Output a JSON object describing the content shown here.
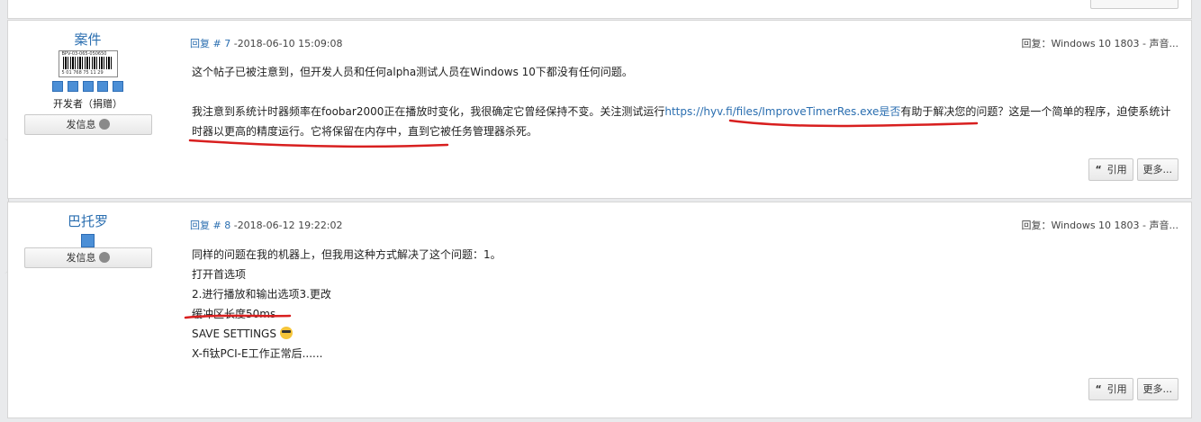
{
  "posts": [
    {
      "author": "案件",
      "role": "开发者（捐赠）",
      "rank_image_text": {
        "top": "BPV-03-065-050650",
        "bottom": "5 01 768 75 11 29"
      },
      "stars": 5,
      "pm_label": "发信息",
      "reply_label": "回复 # 7",
      "timestamp": "-2018-06-10 15:09:08",
      "forum": "回复：Windows 10 1803 - 声音...",
      "body": {
        "p1": "这个帖子已被注意到，但开发人员和任何alpha测试人员在Windows 10下都没有任何问题。",
        "p2_before": "我注意到系统计时器频率在foobar2000正在播放时变化，我很确定它曾经保持不变。关注测试运行",
        "link": "https://hyv.fi/files/ImproveTimerRes.exe是否",
        "p2_after": "有助于解决您的问题？这是一个简单的程序，迫使系统计时器以更高的精度运行。它将保留在内存中，直到它被任务管理器杀死。"
      },
      "quote_label": "引用",
      "more_label": "更多..."
    },
    {
      "author": "巴托罗",
      "stars": 1,
      "pm_label": "发信息",
      "reply_label": "回复 # 8",
      "timestamp": "-2018-06-12 19:22:02",
      "forum": "回复：Windows 10 1803 - 声音...",
      "body": {
        "l1": "同样的问题在我的机器上，但我用这种方式解决了这个问题：1。",
        "l2": "打开首选项",
        "l3": "2.进行播放和输出选项3.更改",
        "l4": "缓冲区长度50ms",
        "l5": "SAVE SETTINGS",
        "l6": "X-fi钛PCI-E工作正常后......"
      },
      "emoji_icon": "sunglasses-emoji-icon",
      "quote_label": "引用",
      "more_label": "更多..."
    }
  ],
  "colors": {
    "link": "#2a6eb0",
    "annotation": "#d81f1f",
    "star": "#4c8fd6"
  }
}
